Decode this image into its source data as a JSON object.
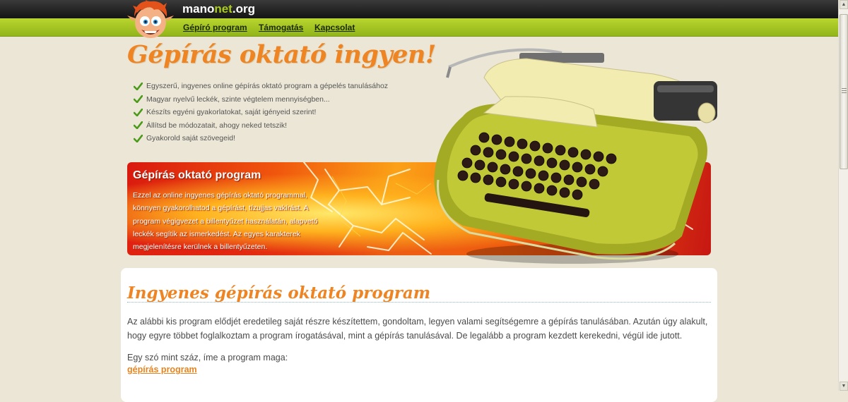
{
  "header": {
    "site_name_main": "mano",
    "site_name_accent": "net",
    "site_name_tld": ".org"
  },
  "nav": {
    "items": [
      {
        "label": "Gépíró program"
      },
      {
        "label": "Támogatás"
      },
      {
        "label": "Kapcsolat"
      }
    ]
  },
  "hero": {
    "title": "Gépírás oktató ingyen!",
    "features": [
      "Egyszerű, ingyenes online gépírás oktató program a gépelés tanulásához",
      "Magyar nyelvű leckék, szinte végtelem mennyiségben...",
      "Készíts egyéni gyakorlatokat, saját igényeid szerint!",
      "Állítsd be módozatait, ahogy neked tetszik!",
      "Gyakorold saját szövegeid!"
    ]
  },
  "banner": {
    "title": "Gépírás oktató program",
    "text": "Ezzel az online ingyenes gépírás oktató programmal, könnyen gyakorolhatod a gépírást, tízujjas vakírást. A program végigvezet a billentyűzet használatán, alapvető leckék segítik az ismerkedést. Az egyes karakterek megjelenítésre kerülnek a billentyűzeten."
  },
  "main": {
    "heading": "Ingyenes gépírás oktató program",
    "paragraph1": "Az alábbi kis program elődjét eredetileg saját részre készítettem, gondoltam, legyen valami segítségemre a gépírás tanulásában. Azután úgy alakult, hogy egyre többet foglalkoztam a program írogatásával, mint a gépírás tanulásával. De legalább a program kezdett kerekedni, végül ide jutott.",
    "paragraph2": "Egy szó mint száz, íme a program maga:",
    "program_link": "gépírás program"
  },
  "colors": {
    "accent_orange": "#ee8422",
    "nav_green": "#a9c924",
    "page_bg": "#ece6d6",
    "banner_red": "#d9180e"
  },
  "icons": {
    "logo": "elf-mascot-logo",
    "feature_bullet": "green-checkmark-icon",
    "hero_image": "green-typewriter"
  }
}
